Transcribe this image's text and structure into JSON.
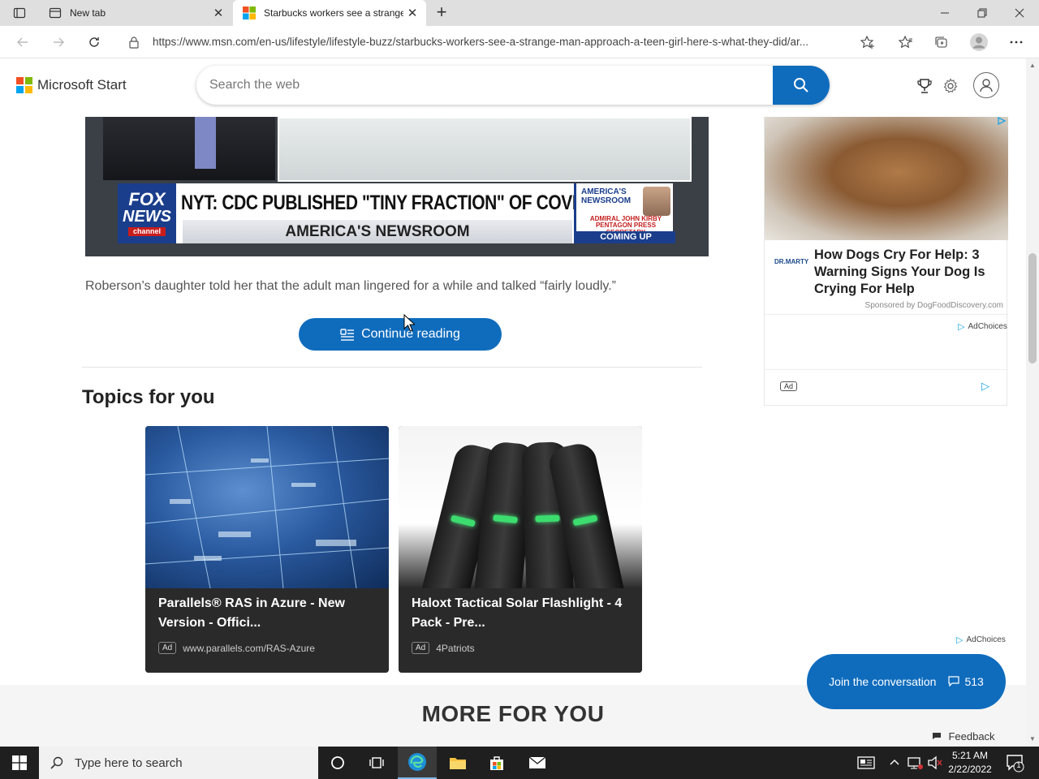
{
  "browser": {
    "tabs": [
      {
        "title": "New tab",
        "active": false
      },
      {
        "title": "Starbucks workers see a strange",
        "active": true
      }
    ],
    "url": "https://www.msn.com/en-us/lifestyle/lifestyle-buzz/starbucks-workers-see-a-strange-man-approach-a-teen-girl-here-s-what-they-did/ar..."
  },
  "header": {
    "brand": "Microsoft Start",
    "search_placeholder": "Search the web"
  },
  "video": {
    "network_line1": "FOX",
    "network_line2": "NEWS",
    "network_line3": "channel",
    "headline": "NYT: CDC PUBLISHED \"TINY FRACTION\" OF COVID DATA",
    "show": "AMERICA'S NEWSROOM",
    "promo_show": "AMERICA'S NEWSROOM",
    "promo_name": "ADMIRAL JOHN KIRBY PENTAGON PRESS SECRETARY",
    "promo_cta": "COMING UP"
  },
  "article": {
    "paragraph": "Roberson’s daughter told her that the adult man lingered for a while and talked “fairly loudly.”",
    "continue_label": "Continue reading"
  },
  "topics": {
    "title": "Topics for you",
    "cards": [
      {
        "title": "Parallels® RAS in Azure - New Version - Offici...",
        "ad": "Ad",
        "source": "www.parallels.com/RAS-Azure"
      },
      {
        "title": "Haloxt Tactical Solar Flashlight - 4 Pack - Pre...",
        "ad": "Ad",
        "source": "4Patriots"
      }
    ]
  },
  "sidebar_ad": {
    "logo": "DR.MARTY",
    "title": "How Dogs Cry For Help: 3 Warning Signs Your Dog Is Crying For Help",
    "sponsor": "Sponsored by DogFoodDiscovery.com",
    "adchoices": "AdChoices",
    "badge": "Ad"
  },
  "adchoices_lower": "AdChoices",
  "more_for_you": "MORE FOR YOU",
  "conversation": {
    "label": "Join the conversation",
    "count": "513"
  },
  "feedback": "Feedback",
  "taskbar": {
    "search_placeholder": "Type here to search",
    "time": "5:21 AM",
    "date": "2/22/2022",
    "notification_count": "1"
  },
  "colors": {
    "accent": "#0f6cbd",
    "ms_red": "#f25022",
    "ms_green": "#7fba00",
    "ms_blue": "#00a4ef",
    "ms_yellow": "#ffb900"
  }
}
